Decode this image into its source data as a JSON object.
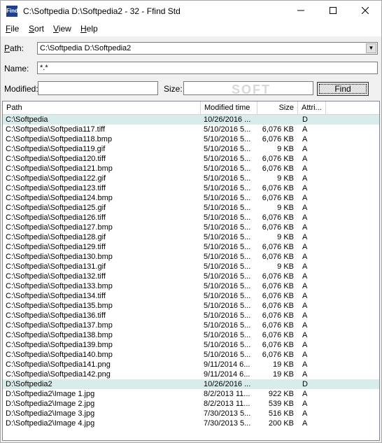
{
  "window": {
    "title": "C:\\Softpedia D:\\Softpedia2 - 32 - Ffind Std",
    "icon_text": "Find"
  },
  "menu": [
    {
      "label": "File",
      "accel": "F",
      "rest": "ile"
    },
    {
      "label": "Sort",
      "accel": "S",
      "rest": "ort"
    },
    {
      "label": "View",
      "accel": "V",
      "rest": "iew"
    },
    {
      "label": "Help",
      "accel": "H",
      "rest": "elp"
    }
  ],
  "form": {
    "path_label_accel": "P",
    "path_label_rest": "ath:",
    "path_value": "C:\\Softpedia D:\\Softpedia2",
    "name_label": "Name:",
    "name_value": "*.*",
    "modified_label": "Modified:",
    "modified_value": "",
    "size_label": "Size:",
    "size_value": "",
    "find_label": "Find"
  },
  "watermark": "SOFT",
  "table": {
    "headers": [
      "Path",
      "Modified time",
      "Size",
      "Attri..."
    ],
    "rows": [
      {
        "path": "C:\\Softpedia",
        "mod": "10/26/2016 ...",
        "size": "",
        "attr": "D",
        "dir": true
      },
      {
        "path": "C:\\Softpedia\\Softpedia117.tiff",
        "mod": "5/10/2016 5...",
        "size": "6,076 KB",
        "attr": "A"
      },
      {
        "path": "C:\\Softpedia\\Softpedia118.bmp",
        "mod": "5/10/2016 5...",
        "size": "6,076 KB",
        "attr": "A"
      },
      {
        "path": "C:\\Softpedia\\Softpedia119.gif",
        "mod": "5/10/2016 5...",
        "size": "9 KB",
        "attr": "A"
      },
      {
        "path": "C:\\Softpedia\\Softpedia120.tiff",
        "mod": "5/10/2016 5...",
        "size": "6,076 KB",
        "attr": "A"
      },
      {
        "path": "C:\\Softpedia\\Softpedia121.bmp",
        "mod": "5/10/2016 5...",
        "size": "6,076 KB",
        "attr": "A"
      },
      {
        "path": "C:\\Softpedia\\Softpedia122.gif",
        "mod": "5/10/2016 5...",
        "size": "9 KB",
        "attr": "A"
      },
      {
        "path": "C:\\Softpedia\\Softpedia123.tiff",
        "mod": "5/10/2016 5...",
        "size": "6,076 KB",
        "attr": "A"
      },
      {
        "path": "C:\\Softpedia\\Softpedia124.bmp",
        "mod": "5/10/2016 5...",
        "size": "6,076 KB",
        "attr": "A"
      },
      {
        "path": "C:\\Softpedia\\Softpedia125.gif",
        "mod": "5/10/2016 5...",
        "size": "9 KB",
        "attr": "A"
      },
      {
        "path": "C:\\Softpedia\\Softpedia126.tiff",
        "mod": "5/10/2016 5...",
        "size": "6,076 KB",
        "attr": "A"
      },
      {
        "path": "C:\\Softpedia\\Softpedia127.bmp",
        "mod": "5/10/2016 5...",
        "size": "6,076 KB",
        "attr": "A"
      },
      {
        "path": "C:\\Softpedia\\Softpedia128.gif",
        "mod": "5/10/2016 5...",
        "size": "9 KB",
        "attr": "A"
      },
      {
        "path": "C:\\Softpedia\\Softpedia129.tiff",
        "mod": "5/10/2016 5...",
        "size": "6,076 KB",
        "attr": "A"
      },
      {
        "path": "C:\\Softpedia\\Softpedia130.bmp",
        "mod": "5/10/2016 5...",
        "size": "6,076 KB",
        "attr": "A"
      },
      {
        "path": "C:\\Softpedia\\Softpedia131.gif",
        "mod": "5/10/2016 5...",
        "size": "9 KB",
        "attr": "A"
      },
      {
        "path": "C:\\Softpedia\\Softpedia132.tiff",
        "mod": "5/10/2016 5...",
        "size": "6,076 KB",
        "attr": "A"
      },
      {
        "path": "C:\\Softpedia\\Softpedia133.bmp",
        "mod": "5/10/2016 5...",
        "size": "6,076 KB",
        "attr": "A"
      },
      {
        "path": "C:\\Softpedia\\Softpedia134.tiff",
        "mod": "5/10/2016 5...",
        "size": "6,076 KB",
        "attr": "A"
      },
      {
        "path": "C:\\Softpedia\\Softpedia135.bmp",
        "mod": "5/10/2016 5...",
        "size": "6,076 KB",
        "attr": "A"
      },
      {
        "path": "C:\\Softpedia\\Softpedia136.tiff",
        "mod": "5/10/2016 5...",
        "size": "6,076 KB",
        "attr": "A"
      },
      {
        "path": "C:\\Softpedia\\Softpedia137.bmp",
        "mod": "5/10/2016 5...",
        "size": "6,076 KB",
        "attr": "A"
      },
      {
        "path": "C:\\Softpedia\\Softpedia138.bmp",
        "mod": "5/10/2016 5...",
        "size": "6,076 KB",
        "attr": "A"
      },
      {
        "path": "C:\\Softpedia\\Softpedia139.bmp",
        "mod": "5/10/2016 5...",
        "size": "6,076 KB",
        "attr": "A"
      },
      {
        "path": "C:\\Softpedia\\Softpedia140.bmp",
        "mod": "5/10/2016 5...",
        "size": "6,076 KB",
        "attr": "A"
      },
      {
        "path": "C:\\Softpedia\\Softpedia141.png",
        "mod": "9/11/2014 6...",
        "size": "19 KB",
        "attr": "A"
      },
      {
        "path": "C:\\Softpedia\\Softpedia142.png",
        "mod": "9/11/2014 6...",
        "size": "19 KB",
        "attr": "A"
      },
      {
        "path": "D:\\Softpedia2",
        "mod": "10/26/2016 ...",
        "size": "",
        "attr": "D",
        "dir": true
      },
      {
        "path": "D:\\Softpedia2\\Image 1.jpg",
        "mod": "8/2/2013 11...",
        "size": "922 KB",
        "attr": "A"
      },
      {
        "path": "D:\\Softpedia2\\Image 2.jpg",
        "mod": "8/2/2013 11...",
        "size": "539 KB",
        "attr": "A"
      },
      {
        "path": "D:\\Softpedia2\\Image 3.jpg",
        "mod": "7/30/2013 5...",
        "size": "516 KB",
        "attr": "A"
      },
      {
        "path": "D:\\Softpedia2\\Image 4.jpg",
        "mod": "7/30/2013 5...",
        "size": "200 KB",
        "attr": "A"
      }
    ]
  },
  "colors": {
    "dir_row_bg": "#d9ecec",
    "window_bg": "#f0f0f0"
  }
}
